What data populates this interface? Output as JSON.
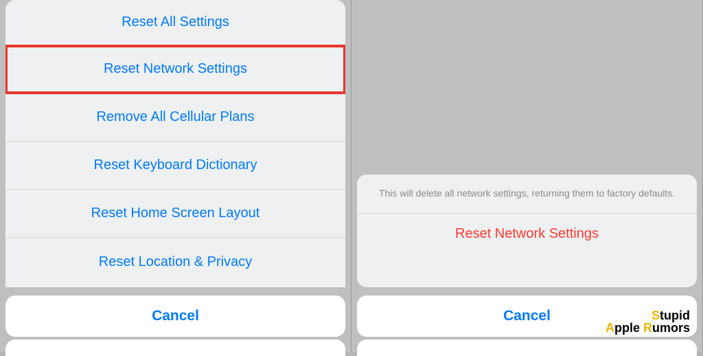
{
  "left": {
    "items": [
      {
        "label": "Reset All Settings",
        "highlighted": false
      },
      {
        "label": "Reset Network Settings",
        "highlighted": true
      },
      {
        "label": "Remove All Cellular Plans",
        "highlighted": false
      },
      {
        "label": "Reset Keyboard Dictionary",
        "highlighted": false
      },
      {
        "label": "Reset Home Screen Layout",
        "highlighted": false
      },
      {
        "label": "Reset Location & Privacy",
        "highlighted": false
      }
    ],
    "cancel": "Cancel"
  },
  "right": {
    "message": "This will delete all network settings, returning them to factory defaults.",
    "confirm": "Reset Network Settings",
    "cancel": "Cancel"
  },
  "watermark": {
    "s": "S",
    "tupid": "tupid",
    "a": "A",
    "pple": "pple ",
    "r": "R",
    "umors": "umors"
  }
}
